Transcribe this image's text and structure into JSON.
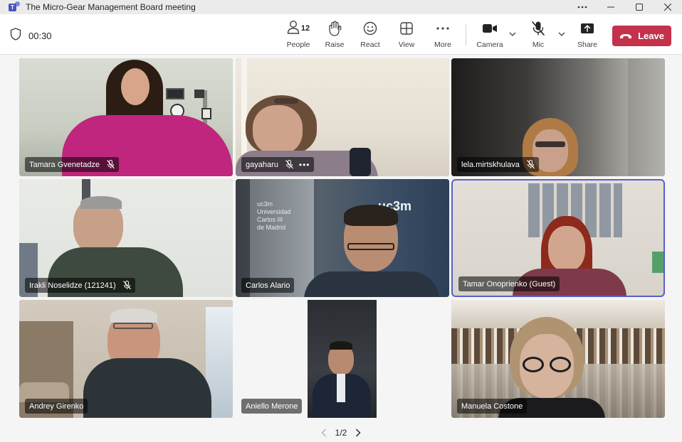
{
  "window": {
    "title": "The Micro-Gear Management Board meeting",
    "controls": [
      "more-options",
      "minimize",
      "maximize",
      "close"
    ]
  },
  "toolbar": {
    "timer": "00:30",
    "people_label": "People",
    "people_count": "12",
    "raise_label": "Raise",
    "react_label": "React",
    "view_label": "View",
    "more_label": "More",
    "camera_label": "Camera",
    "mic_label": "Mic",
    "share_label": "Share",
    "leave_label": "Leave",
    "leave_color": "#c4314b"
  },
  "participants": [
    {
      "name": "Tamara Gvenetadze",
      "muted": true
    },
    {
      "name": "gayaharu",
      "muted": true,
      "more": true
    },
    {
      "name": "lela.mirtskhulava",
      "muted": true
    },
    {
      "name": "Irakli Noselidze (121241)",
      "muted": true
    },
    {
      "name": "Carlos Alario",
      "muted": false
    },
    {
      "name": "Tamar Onoprienko (Guest)",
      "muted": false,
      "active": true
    },
    {
      "name": "Andrey Girenko",
      "muted": false
    },
    {
      "name": "Aniello Merone",
      "muted": false
    },
    {
      "name": "Manuela Costone",
      "muted": false
    }
  ],
  "pagination": {
    "label": "1/2"
  },
  "colors": {
    "accent": "#5b5fc7",
    "app_icon": "#4b53bc"
  }
}
